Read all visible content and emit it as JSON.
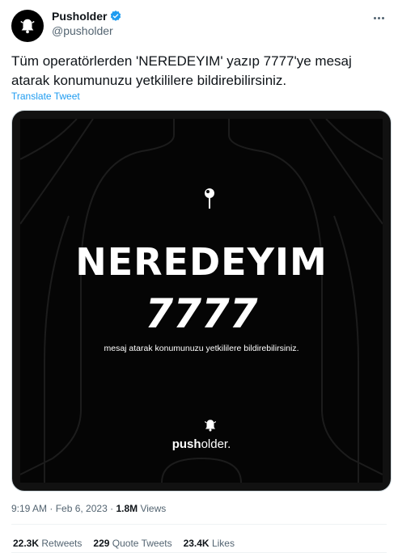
{
  "author": {
    "display_name": "Pusholder",
    "handle": "@pusholder",
    "verified": true,
    "avatar_icon": "bell-icon"
  },
  "tweet": {
    "text": "Tüm operatörlerden 'NEREDEYIM' yazıp 7777'ye mesaj atarak konumunuzu yetkililere bildirebilirsiniz.",
    "translate_label": "Translate Tweet"
  },
  "media": {
    "headline": "NEREDEYIM",
    "number": "7777",
    "subline": "mesaj atarak konumunuzu yetkililere bildirebilirsiniz.",
    "brand_bold": "push",
    "brand_light": "older.",
    "pin_icon": "location-pin-icon",
    "logo_icon": "bell-icon"
  },
  "meta": {
    "time": "9:19 AM",
    "separator1": " · ",
    "date": "Feb 6, 2023",
    "separator2": " · ",
    "views_count": "1.8M",
    "views_label": " Views"
  },
  "stats": {
    "retweets_count": "22.3K",
    "retweets_label": " Retweets",
    "quotes_count": "229",
    "quotes_label": " Quote Tweets",
    "likes_count": "23.4K",
    "likes_label": " Likes"
  },
  "colors": {
    "accent": "#1d9bf0",
    "text": "#0f1419",
    "muted": "#536471",
    "media_bg": "#050505"
  }
}
